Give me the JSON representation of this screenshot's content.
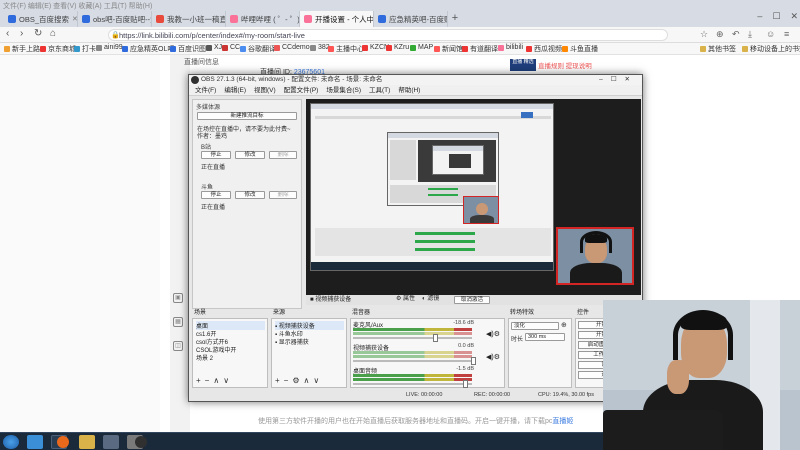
{
  "browser": {
    "window_title": "文件(F)  编辑(E)  查看(V)  收藏(A)  工具(T)  帮助(H)",
    "tabs": [
      {
        "label": "OBS_百度搜索",
        "color": "#2f6bdc",
        "active": false
      },
      {
        "label": "obs吧-百度贴吧--免费的屏幕录",
        "color": "#2f6bdc",
        "active": false
      },
      {
        "label": "我教一小班一稿直播_应急精英",
        "color": "#e84a3c",
        "active": false
      },
      {
        "label": "哔哩哔哩 ( ゜- ゜)つロ 干杯~-b",
        "color": "#fb7299",
        "active": false
      },
      {
        "label": "开播设置 - 个人中心 - bilibili",
        "color": "#fb7299",
        "active": true
      },
      {
        "label": "应急精英吧-百度贴吧--本吧",
        "color": "#2f6bdc",
        "active": false
      }
    ],
    "url": "https://link.bilibili.com/p/center/index#/my-room/start-live",
    "bookmarks": [
      "新手上路",
      "京东商城",
      "打卡",
      "aini99",
      "应急精英OL吧",
      "百度识图",
      "XJ",
      "CC",
      "谷歌翻译",
      "CCdemo",
      "382",
      "主播中心",
      "KZCN",
      "KZru",
      "MAP",
      "新闻馆",
      "有道翻译",
      "bilibili",
      "西瓜视频",
      "斗鱼直播",
      "其他书签",
      "移动设备上的书签"
    ]
  },
  "webpage": {
    "sidebar_label": "直播间信息",
    "room_id_label": "直播间 ID:",
    "room_id": "23675601",
    "ad_badge": "直播 精选",
    "ad_links": "直播规则  提现说明",
    "footer_text": "使用第三方软件开播的用户也在开始直播后获取服务器地址和直播码。开启一键开播，请下载pc",
    "footer_link": "直播姬"
  },
  "obs": {
    "title": "OBS 27.1.3 (64-bit, windows) - 配置文件: 未命名 - 场景: 未命名",
    "menu": [
      "文件(F)",
      "编辑(E)",
      "视图(V)",
      "配置文件(P)",
      "场景集合(S)",
      "工具(T)",
      "帮助(H)"
    ],
    "left_dock_title": "多媒体源",
    "left_panel": {
      "new_button": "新建推流目标",
      "hint_line1": "在场控在直播中，请不要为此付费~",
      "hint_line2": "作者：墨鸡",
      "section1": "B站",
      "section2": "斗鱼",
      "stop": "停止",
      "edit": "修改",
      "delete": "删除",
      "live_status": "正在直播"
    },
    "preview_source_bar": {
      "label": "视频捕获设备",
      "props": "属性",
      "filters": "滤镜",
      "deactivate": "取消激活"
    },
    "scenes": {
      "title": "场景",
      "items": [
        "桌面",
        "cs1.6开",
        "csol方式开6",
        "CSOL游戏中开",
        "场景 2"
      ]
    },
    "sources": {
      "title": "来源",
      "items": [
        "视频捕获设备",
        "斗鱼水印",
        "显示器捕获"
      ]
    },
    "mixer": {
      "title": "混音器",
      "channels": [
        {
          "name": "麦克风/Aux",
          "db": "-18.6 dB"
        },
        {
          "name": "视频捕获设备",
          "db": "0.0 dB"
        },
        {
          "name": "桌面音频",
          "db": "-1.5 dB"
        }
      ]
    },
    "transitions": {
      "title": "转场特效",
      "type": "淡化",
      "duration_label": "时长",
      "duration": "300 ms"
    },
    "controls": {
      "title": "控件",
      "buttons": [
        "开始推流",
        "开始录制",
        "启动虚拟摄像机",
        "工作室模式",
        "设置",
        "退出"
      ]
    },
    "status": {
      "live": "LIVE: 00:00:00",
      "rec": "REC: 00:00:00",
      "cpu": "CPU: 19.4%, 30.00 fps"
    }
  }
}
